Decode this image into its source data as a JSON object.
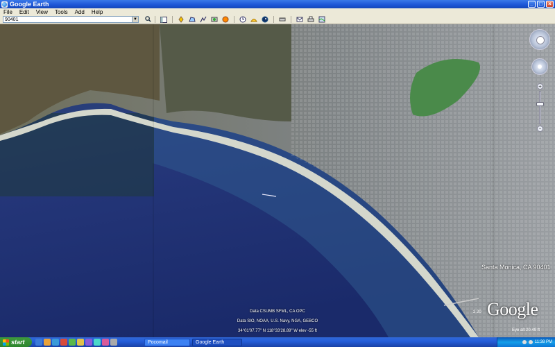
{
  "window": {
    "title": "Google Earth"
  },
  "menu": [
    "File",
    "Edit",
    "View",
    "Tools",
    "Add",
    "Help"
  ],
  "search": {
    "value": "90401"
  },
  "view": {
    "place_label": "Santa Monica, CA 90401",
    "source_line1": "Data SIO, NOAA, U.S. Navy, NGA, GEBCO",
    "source_line2": "Data CSUMB SFML, CA OPC",
    "status": "34°01'07.77\" N    118°33'28.89\" W    elev  -55 ft",
    "pointer": "2 20",
    "eye_alt": "Eye alt  20.49 ft",
    "logo": "Google"
  },
  "taskbar": {
    "start_label": "start",
    "tasks": [
      {
        "label": "Pocomail",
        "active": false
      },
      {
        "label": "Google Earth",
        "active": true
      }
    ],
    "clock": "11:38 PM"
  },
  "colors": {
    "ocean": "#1e2f6e",
    "land": "#6b6b52",
    "beach": "#cfd3c9",
    "city": "#8a8d90"
  }
}
